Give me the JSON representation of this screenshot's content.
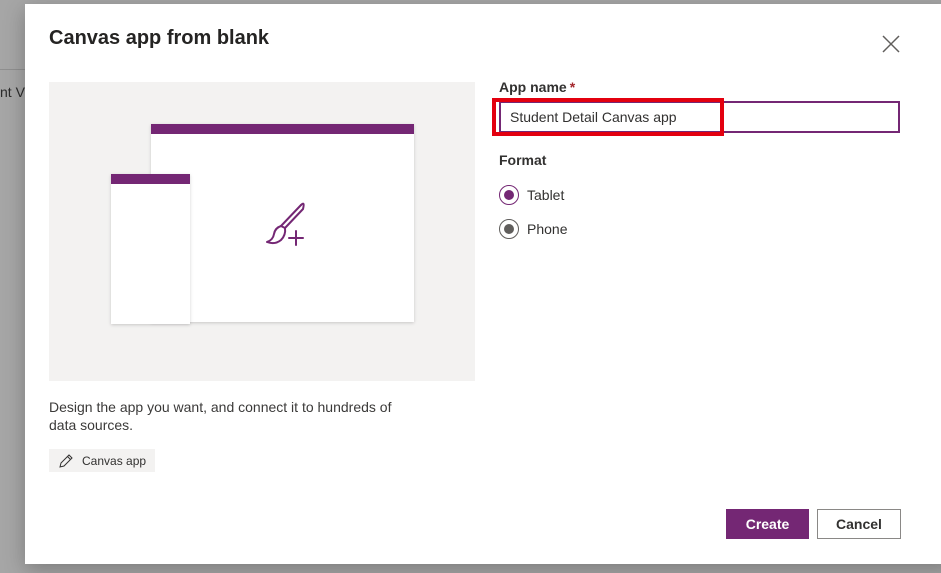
{
  "background": {
    "partial_text": "nt V"
  },
  "dialog": {
    "title": "Canvas app from blank",
    "description": "Design the app you want, and connect it to hundreds of data sources.",
    "tag_label": "Canvas app",
    "app_name_label": "App name",
    "required_marker": "*",
    "app_name_value": "Student Detail Canvas app",
    "format_label": "Format",
    "format_options": [
      {
        "label": "Tablet",
        "selected": true
      },
      {
        "label": "Phone",
        "selected": false
      }
    ],
    "create_label": "Create",
    "cancel_label": "Cancel"
  },
  "colors": {
    "accent": "#742774",
    "highlight": "#e3000f",
    "preview_bg": "#f3f2f1"
  },
  "icons": {
    "close": "close-icon",
    "brush_add": "brush-add-icon",
    "pencil": "pencil-icon"
  }
}
